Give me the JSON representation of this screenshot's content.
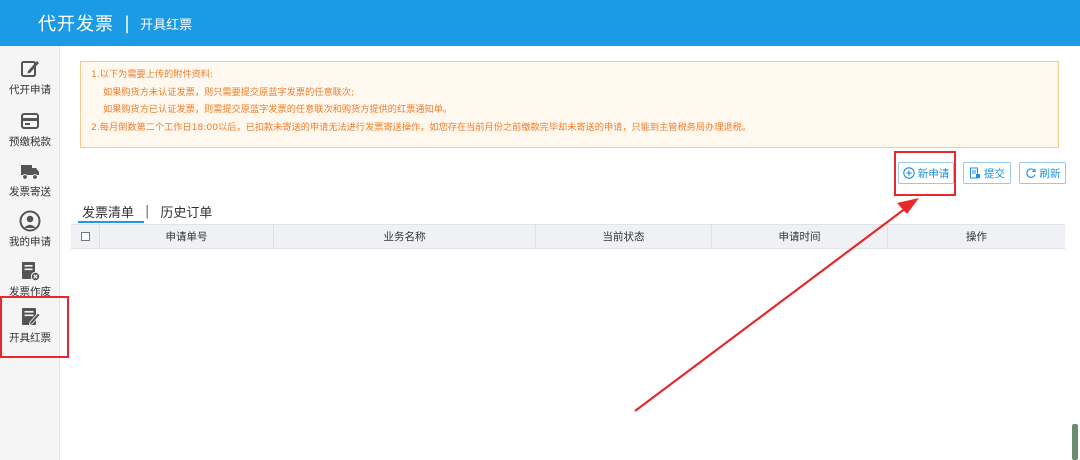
{
  "header": {
    "app_title": "代开发票",
    "separator": "|",
    "page_title": "开具红票"
  },
  "sidebar": {
    "items": [
      {
        "label": "代开申请",
        "icon": "edit-document-icon"
      },
      {
        "label": "预缴税款",
        "icon": "payment-card-icon"
      },
      {
        "label": "发票寄送",
        "icon": "delivery-truck-icon"
      },
      {
        "label": "我的申请",
        "icon": "user-icon"
      },
      {
        "label": "发票作废",
        "icon": "void-invoice-icon"
      },
      {
        "label": "开具红票",
        "icon": "red-invoice-icon",
        "active": true
      }
    ]
  },
  "notice": {
    "lines": [
      "1.以下为需要上传的附件资料:",
      "如果购货方未认证发票，则只需要提交原蓝字发票的任意联次;",
      "如果购货方已认证发票，则需提交原蓝字发票的任意联次和购货方提供的红票通知单。",
      "2.每月倒数第二个工作日18:00以后，已扣款未寄送的申请无法进行发票寄送操作，如您存在当前月份之前缴款完毕却未寄送的申请，只能到主管税务局办理退税。"
    ]
  },
  "toolbar": {
    "new_label": "新申请",
    "submit_label": "提交",
    "refresh_label": "刷新"
  },
  "tabs": {
    "active": "发票清单",
    "separator": "|",
    "history": "历史订单"
  },
  "table": {
    "columns": [
      "申请单号",
      "业务名称",
      "当前状态",
      "申请时间",
      "操作"
    ],
    "rows": []
  },
  "colors": {
    "header_bg": "#1b9be6",
    "notice_text": "#f07d2a",
    "notice_border": "#f6c98f",
    "highlight": "#e9282b"
  }
}
